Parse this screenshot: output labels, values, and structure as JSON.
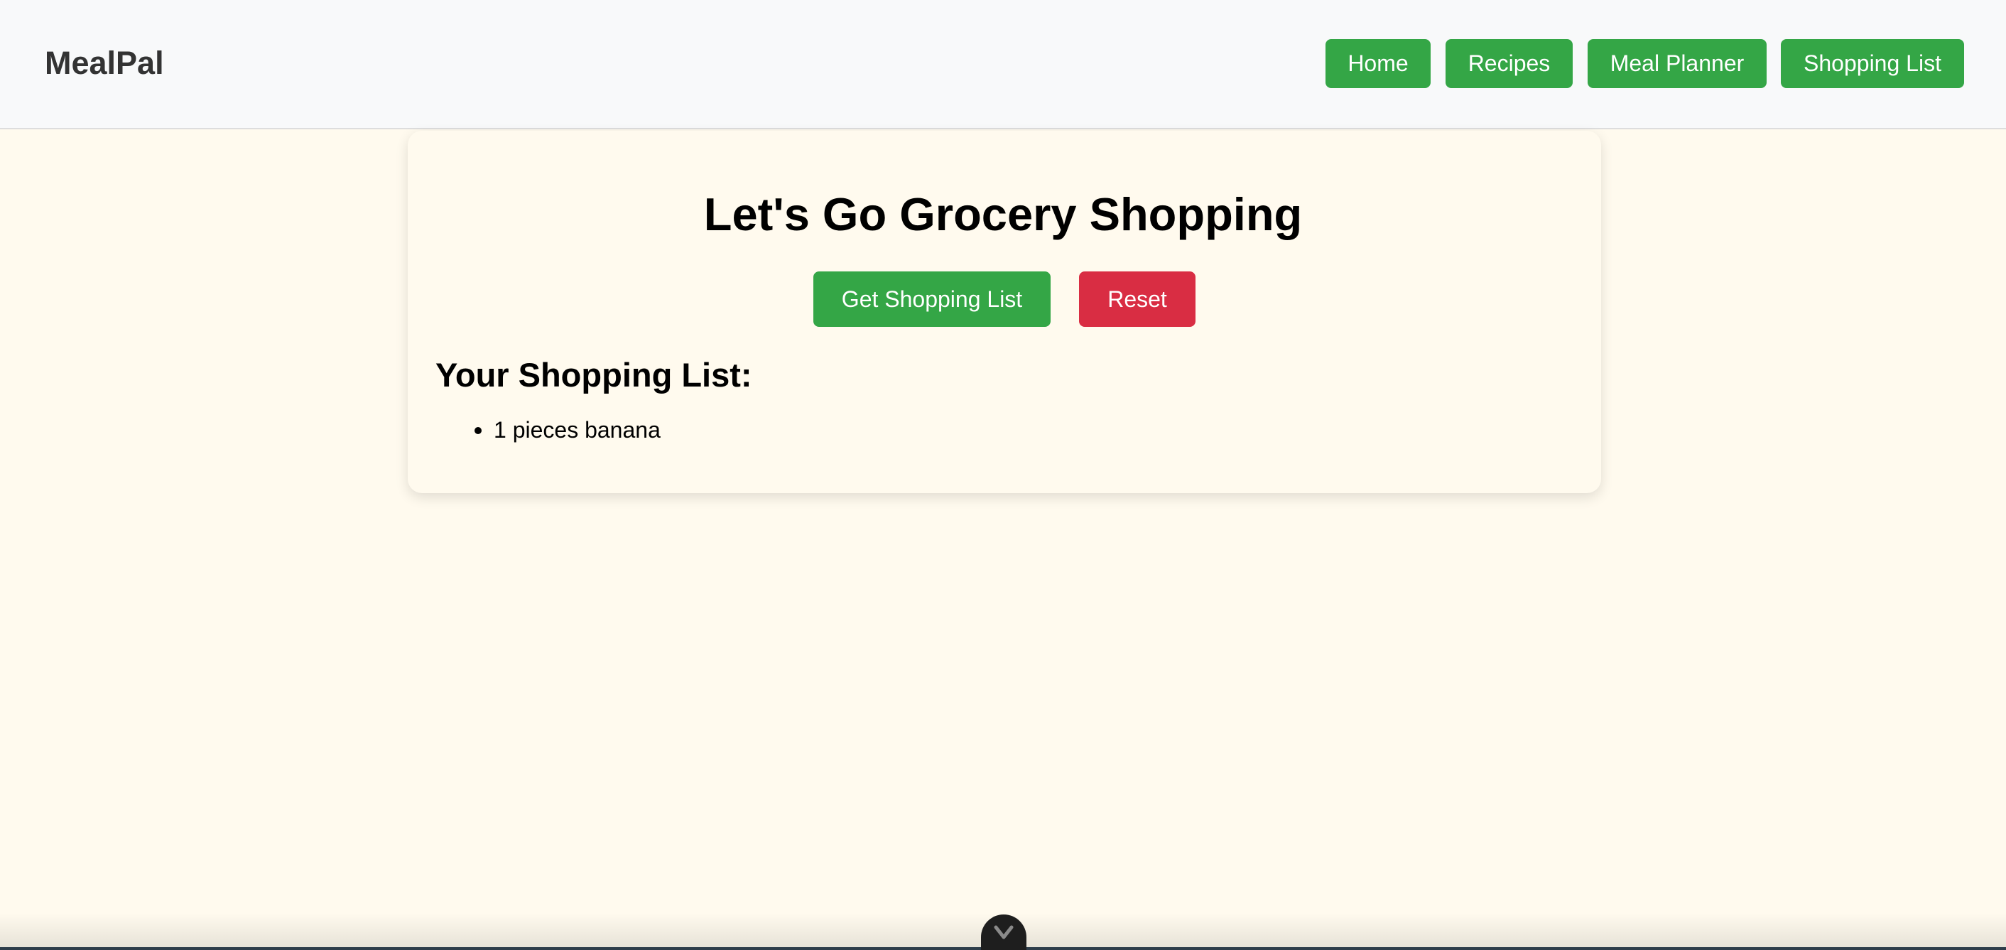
{
  "app": {
    "brand": "MealPal"
  },
  "nav": {
    "items": [
      {
        "label": "Home"
      },
      {
        "label": "Recipes"
      },
      {
        "label": "Meal Planner"
      },
      {
        "label": "Shopping List"
      }
    ]
  },
  "main": {
    "title": "Let's Go Grocery Shopping",
    "get_button": "Get Shopping List",
    "reset_button": "Reset",
    "list_heading": "Your Shopping List:",
    "items": [
      "1 pieces banana"
    ]
  },
  "colors": {
    "accent_green": "#34a646",
    "danger_red": "#d92d43",
    "page_background": "#fffaee",
    "navbar_background": "#f8f9fa"
  },
  "icons": {
    "toggle": "chevron-down-icon"
  }
}
